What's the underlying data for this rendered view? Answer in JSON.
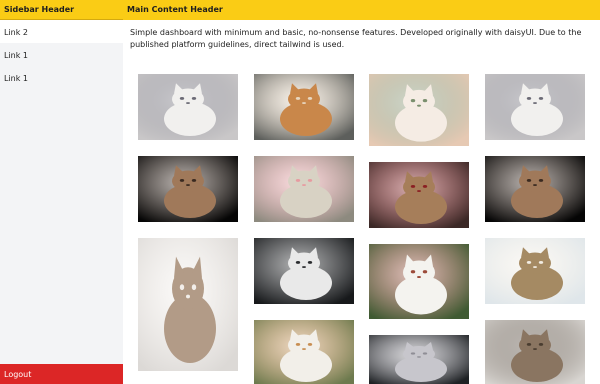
{
  "sidebar": {
    "header": "Sidebar Header",
    "items": [
      {
        "label": "Link 2",
        "active": true
      },
      {
        "label": "Link 1",
        "active": false
      },
      {
        "label": "Link 1",
        "active": false
      }
    ],
    "logout_label": "Logout"
  },
  "main": {
    "header": "Main Content Header",
    "description": "Simple dashboard with minimum and basic, no-nonsense features. Developed originally with daisyUI. Due to the published platform guidelines, direct tailwind is used."
  },
  "gallery": {
    "photos": [
      {
        "subject": "white-siamese-cat",
        "bg": "#c9c7c8",
        "fg": "#f1f0ee",
        "accent": "#6b6a75"
      },
      {
        "subject": "orange-tabby-lying",
        "bg": "#5d5f5c",
        "fg": "#c9874a",
        "accent": "#e8d7c1"
      },
      {
        "subject": "kitten-on-bed",
        "bg": "#e6c9b3",
        "fg": "#f5ece4",
        "accent": "#7a8f6e"
      },
      {
        "subject": "white-siamese-cat",
        "bg": "#c9c7c8",
        "fg": "#f1f0ee",
        "accent": "#6b6a75"
      },
      {
        "subject": "tabby-on-black",
        "bg": "#050505",
        "fg": "#a0795a",
        "accent": "#3a2a20"
      },
      {
        "subject": "yawning-cat",
        "bg": "#8d8a7f",
        "fg": "#d8d2c4",
        "accent": "#e79aa0"
      },
      {
        "subject": "cat-on-red-blanket",
        "bg": "#3b2826",
        "fg": "#a67e5a",
        "accent": "#8b1f22"
      },
      {
        "subject": "tabby-on-black",
        "bg": "#050505",
        "fg": "#a0795a",
        "accent": "#3a2a20"
      },
      {
        "subject": "sleeping-tabby",
        "bg": "#dcd9d6",
        "fg": "#b29b87",
        "accent": "#f2eeea"
      },
      {
        "subject": "black-white-cat",
        "bg": "#17191b",
        "fg": "#e9e9e9",
        "accent": "#2a2c2f"
      },
      {
        "subject": "white-cat-garden",
        "bg": "#3f5a32",
        "fg": "#f4f3ef",
        "accent": "#9c4b3a"
      },
      {
        "subject": "cat-in-basket",
        "bg": "#dfe6ea",
        "fg": "#a58a63",
        "accent": "#f2ede3"
      },
      {
        "subject": "calico-cat",
        "bg": "#6d7a4e",
        "fg": "#f2efe9",
        "accent": "#c88e52"
      },
      {
        "subject": "grey-cat",
        "bg": "#1e2124",
        "fg": "#c7c6cc",
        "accent": "#8f8e96"
      },
      {
        "subject": "tabby-closeup",
        "bg": "#d8d5d1",
        "fg": "#8a7561",
        "accent": "#4a3d30"
      }
    ]
  }
}
